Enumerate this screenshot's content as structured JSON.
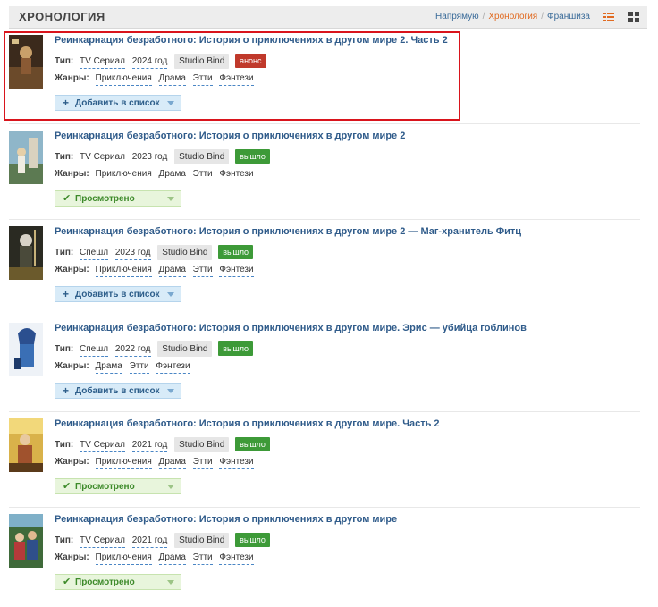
{
  "header": {
    "title": "ХРОНОЛОГИЯ",
    "nav": [
      {
        "label": "Напрямую",
        "active": false
      },
      {
        "label": "Хронология",
        "active": true
      },
      {
        "label": "Франшиза",
        "active": false
      }
    ],
    "separator": "/"
  },
  "labels": {
    "type": "Тип:",
    "genres": "Жанры:"
  },
  "entries": [
    {
      "title": "Реинкарнация безработного: История о приключениях в другом мире 2. Часть 2",
      "type": "TV Сериал",
      "year": "2024 год",
      "studio": "Studio Bind",
      "status": "анонс",
      "status_kind": "announce",
      "genres": [
        "Приключения",
        "Драма",
        "Этти",
        "Фэнтези"
      ],
      "button": "Добавить в список",
      "button_kind": "add"
    },
    {
      "title": "Реинкарнация безработного: История о приключениях в другом мире 2",
      "type": "TV Сериал",
      "year": "2023 год",
      "studio": "Studio Bind",
      "status": "вышло",
      "status_kind": "released",
      "genres": [
        "Приключения",
        "Драма",
        "Этти",
        "Фэнтези"
      ],
      "button": "Просмотрено",
      "button_kind": "watched"
    },
    {
      "title": "Реинкарнация безработного: История о приключениях в другом мире 2 — Маг-хранитель Фитц",
      "type": "Спешл",
      "year": "2023 год",
      "studio": "Studio Bind",
      "status": "вышло",
      "status_kind": "released",
      "genres": [
        "Приключения",
        "Драма",
        "Этти",
        "Фэнтези"
      ],
      "button": "Добавить в список",
      "button_kind": "add"
    },
    {
      "title": "Реинкарнация безработного: История о приключениях в другом мире. Эрис — убийца гоблинов",
      "type": "Спешл",
      "year": "2022 год",
      "studio": "Studio Bind",
      "status": "вышло",
      "status_kind": "released",
      "genres": [
        "Драма",
        "Этти",
        "Фэнтези"
      ],
      "button": "Добавить в список",
      "button_kind": "add"
    },
    {
      "title": "Реинкарнация безработного: История о приключениях в другом мире. Часть 2",
      "type": "TV Сериал",
      "year": "2021 год",
      "studio": "Studio Bind",
      "status": "вышло",
      "status_kind": "released",
      "genres": [
        "Приключения",
        "Драма",
        "Этти",
        "Фэнтези"
      ],
      "button": "Просмотрено",
      "button_kind": "watched"
    },
    {
      "title": "Реинкарнация безработного: История о приключениях в другом мире",
      "type": "TV Сериал",
      "year": "2021 год",
      "studio": "Studio Bind",
      "status": "вышло",
      "status_kind": "released",
      "genres": [
        "Приключения",
        "Драма",
        "Этти",
        "Фэнтези"
      ],
      "button": "Просмотрено",
      "button_kind": "watched"
    }
  ],
  "colors": {
    "accent_link": "#2f5b8a",
    "active_nav": "#e06b22",
    "announce": "#c0392b",
    "released": "#3d9a38",
    "highlight": "#d9141c"
  }
}
